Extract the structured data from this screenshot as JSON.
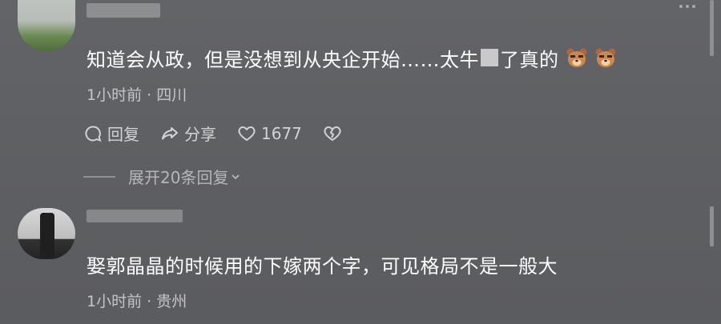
{
  "comments": [
    {
      "text_before_mask": "知道会从政，但是没想到从央企开始……太牛",
      "text_after_mask": "了真的",
      "emojis": [
        "bear-face-icon",
        "bear-face-icon"
      ],
      "time": "1小时前 · 四川",
      "actions": {
        "reply": "回复",
        "share": "分享",
        "likes": "1677"
      },
      "expand_label": "展开20条回复"
    },
    {
      "text": "娶郭晶晶的时候用的下嫁两个字，可见格局不是一般大",
      "time": "1小时前 · 贵州"
    }
  ],
  "colors": {
    "background": "#5f6063",
    "text": "#ffffff",
    "meta": "#c4c5c7"
  }
}
